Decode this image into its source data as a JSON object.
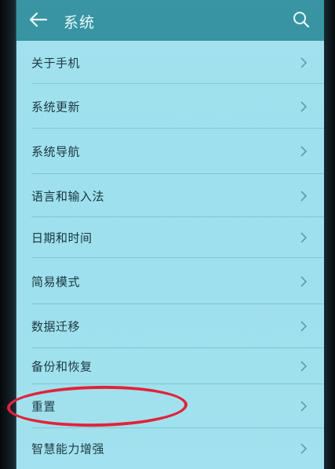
{
  "header": {
    "title": "系统",
    "back_icon": "arrow-left-icon",
    "search_icon": "search-icon"
  },
  "menu": {
    "items": [
      {
        "label": "关于手机"
      },
      {
        "label": "系统更新"
      },
      {
        "label": "系统导航"
      },
      {
        "label": "语言和输入法"
      },
      {
        "label": "日期和时间"
      },
      {
        "label": "简易模式"
      },
      {
        "label": "数据迁移"
      },
      {
        "label": "备份和恢复"
      },
      {
        "label": "重置"
      },
      {
        "label": "智慧能力增强"
      }
    ]
  },
  "colors": {
    "header_bg": "#2f8f9e",
    "list_bg": "#9ee0ee",
    "annotation": "#e2233a"
  }
}
